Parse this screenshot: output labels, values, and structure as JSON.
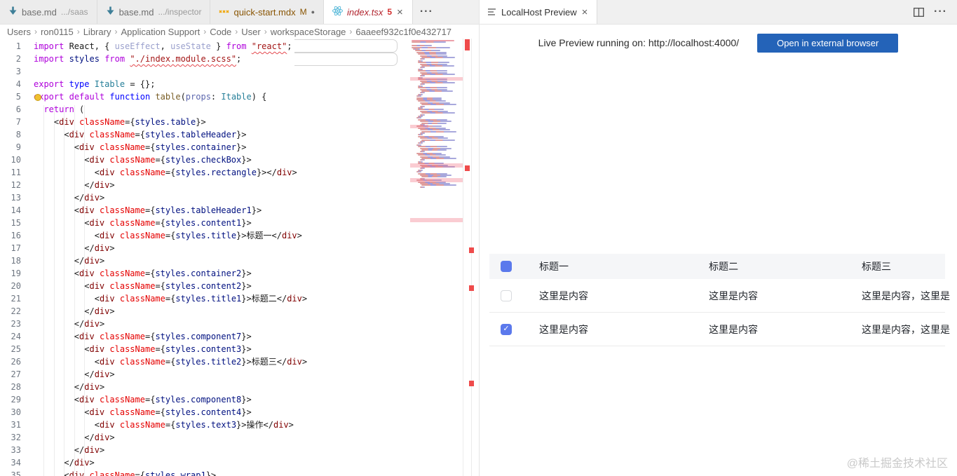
{
  "left_group": {
    "tabs": [
      {
        "icon": "markdown-icon",
        "label": "base.md",
        "desc": ".../saas",
        "state": "inactive"
      },
      {
        "icon": "markdown-icon",
        "label": "base.md",
        "desc": ".../inspector",
        "state": "inactive"
      },
      {
        "icon": "mdx-icon",
        "label": "quick-start.mdx",
        "badge": "M",
        "dirty": true,
        "state": "inactive",
        "label_style": "modified"
      },
      {
        "icon": "react-icon",
        "label": "index.tsx",
        "badge": "5",
        "close": true,
        "state": "active",
        "label_style": "error"
      }
    ],
    "more_actions": "···",
    "breadcrumb": {
      "items": [
        "Users",
        "ron0115",
        "Library",
        "Application Support",
        "Code",
        "User",
        "workspaceStorage",
        "6aaeef932c1f0e432717"
      ],
      "separator": "›"
    },
    "code_lines": [
      {
        "n": 1,
        "ind": 0,
        "tk": [
          [
            "kw",
            "import"
          ],
          [
            "pl",
            " React, { "
          ],
          [
            "fade",
            "useEffect"
          ],
          [
            "pl",
            ", "
          ],
          [
            "fade",
            "useState"
          ],
          [
            "pl",
            " } "
          ],
          [
            "kw",
            "from"
          ],
          [
            "pl",
            " "
          ],
          [
            "sstr",
            "\"react\""
          ],
          [
            "pl",
            ";"
          ]
        ]
      },
      {
        "n": 2,
        "ind": 0,
        "tk": [
          [
            "kw",
            "import"
          ],
          [
            "pl",
            " "
          ],
          [
            "vr",
            "styles"
          ],
          [
            "pl",
            " "
          ],
          [
            "kw",
            "from"
          ],
          [
            "pl",
            " "
          ],
          [
            "sstr",
            "\"./index.module.scss\""
          ],
          [
            "pl",
            ";"
          ]
        ]
      },
      {
        "n": 3,
        "ind": 0,
        "tk": []
      },
      {
        "n": 4,
        "ind": 0,
        "tk": [
          [
            "kw",
            "export"
          ],
          [
            "pl",
            " "
          ],
          [
            "kw2",
            "type"
          ],
          [
            "pl",
            " "
          ],
          [
            "ty",
            "Itable"
          ],
          [
            "pl",
            " = {};"
          ]
        ]
      },
      {
        "n": 5,
        "ind": 0,
        "tk": [
          [
            "kw",
            "export"
          ],
          [
            "pl",
            " "
          ],
          [
            "kw",
            "default"
          ],
          [
            "pl",
            " "
          ],
          [
            "kw2",
            "function"
          ],
          [
            "pl",
            " "
          ],
          [
            "fn",
            "table"
          ],
          [
            "pl",
            "("
          ],
          [
            "pv",
            "props"
          ],
          [
            "pl",
            ": "
          ],
          [
            "ty",
            "Itable"
          ],
          [
            "pl",
            ") {"
          ]
        ]
      },
      {
        "n": 6,
        "ind": 2,
        "tk": [
          [
            "kw",
            "return"
          ],
          [
            "pl",
            " ("
          ]
        ]
      },
      {
        "n": 7,
        "ind": 4,
        "jsx": "open",
        "cls": "table"
      },
      {
        "n": 8,
        "ind": 6,
        "jsx": "open",
        "cls": "tableHeader"
      },
      {
        "n": 9,
        "ind": 8,
        "jsx": "open",
        "cls": "container"
      },
      {
        "n": 10,
        "ind": 10,
        "jsx": "open",
        "cls": "checkBox"
      },
      {
        "n": 11,
        "ind": 12,
        "jsx": "pair",
        "cls": "rectangle"
      },
      {
        "n": 12,
        "ind": 10,
        "jsx": "close"
      },
      {
        "n": 13,
        "ind": 8,
        "jsx": "close"
      },
      {
        "n": 14,
        "ind": 8,
        "jsx": "open",
        "cls": "tableHeader1"
      },
      {
        "n": 15,
        "ind": 10,
        "jsx": "open",
        "cls": "content1"
      },
      {
        "n": 16,
        "ind": 12,
        "jsx": "text",
        "cls": "title",
        "text": "标题一"
      },
      {
        "n": 17,
        "ind": 10,
        "jsx": "close"
      },
      {
        "n": 18,
        "ind": 8,
        "jsx": "close"
      },
      {
        "n": 19,
        "ind": 8,
        "jsx": "open",
        "cls": "container2"
      },
      {
        "n": 20,
        "ind": 10,
        "jsx": "open",
        "cls": "content2"
      },
      {
        "n": 21,
        "ind": 12,
        "jsx": "text",
        "cls": "title1",
        "text": "标题二"
      },
      {
        "n": 22,
        "ind": 10,
        "jsx": "close"
      },
      {
        "n": 23,
        "ind": 8,
        "jsx": "close"
      },
      {
        "n": 24,
        "ind": 8,
        "jsx": "open",
        "cls": "component7"
      },
      {
        "n": 25,
        "ind": 10,
        "jsx": "open",
        "cls": "content3"
      },
      {
        "n": 26,
        "ind": 12,
        "jsx": "text",
        "cls": "title2",
        "text": "标题三"
      },
      {
        "n": 27,
        "ind": 10,
        "jsx": "close"
      },
      {
        "n": 28,
        "ind": 8,
        "jsx": "close"
      },
      {
        "n": 29,
        "ind": 8,
        "jsx": "open",
        "cls": "component8"
      },
      {
        "n": 30,
        "ind": 10,
        "jsx": "open",
        "cls": "content4"
      },
      {
        "n": 31,
        "ind": 12,
        "jsx": "text",
        "cls": "text3",
        "text": "操作"
      },
      {
        "n": 32,
        "ind": 10,
        "jsx": "close"
      },
      {
        "n": 33,
        "ind": 8,
        "jsx": "close"
      },
      {
        "n": 34,
        "ind": 6,
        "jsx": "close"
      },
      {
        "n": 35,
        "ind": 6,
        "jsx": "open",
        "cls": "wrap1"
      }
    ]
  },
  "right_group": {
    "tab_label": "LocalHost Preview",
    "status_label": "Live Preview running on:",
    "url": "http://localhost:4000/",
    "button_label": "Open in external browser",
    "table": {
      "header": {
        "checkbox": "filled",
        "cols": [
          "标题一",
          "标题二",
          "标题三"
        ]
      },
      "rows": [
        {
          "checkbox": "unchecked",
          "cols": [
            "这里是内容",
            "这里是内容",
            "这里是内容，这里是内容"
          ]
        },
        {
          "checkbox": "checked",
          "cols": [
            "这里是内容",
            "这里是内容",
            "这里是内容，这里是内容"
          ]
        }
      ],
      "check_mark": "✓"
    }
  },
  "watermark": "@稀土掘金技术社区",
  "colors": {
    "accent_checkbox": "#5b79ec",
    "button_blue": "#2463b8",
    "error_red": "#e4484d",
    "git_modified": "#895503",
    "tab_error_label": "#b1242e"
  }
}
